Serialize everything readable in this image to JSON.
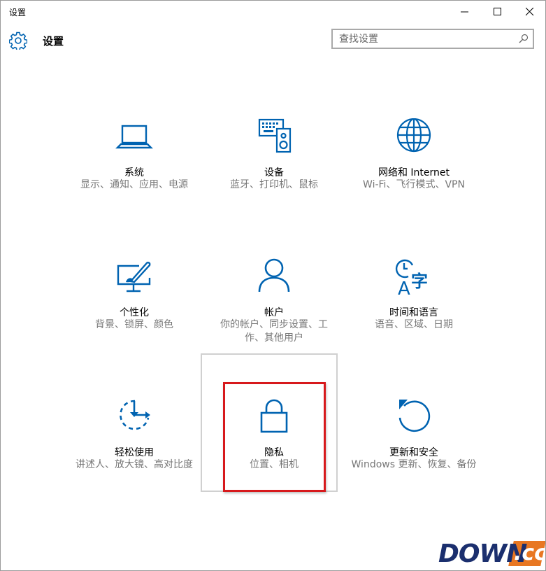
{
  "window": {
    "title": "设置",
    "controls": {
      "minimize": "minimize",
      "maximize": "maximize",
      "close": "close"
    }
  },
  "header": {
    "title": "设置",
    "search": {
      "placeholder": "查找设置",
      "value": ""
    }
  },
  "accent_color": "#0063b1",
  "highlight_color": "#d7191c",
  "tiles": [
    {
      "name": "系统",
      "desc": "显示、通知、应用、电源",
      "icon": "laptop-icon"
    },
    {
      "name": "设备",
      "desc": "蓝牙、打印机、鼠标",
      "icon": "keyboard-speaker-icon"
    },
    {
      "name": "网络和 Internet",
      "desc": "Wi-Fi、飞行模式、VPN",
      "icon": "globe-icon"
    },
    {
      "name": "个性化",
      "desc": "背景、锁屏、颜色",
      "icon": "paint-monitor-icon"
    },
    {
      "name": "帐户",
      "desc": "你的帐户、同步设置、工作、其他用户",
      "icon": "person-icon"
    },
    {
      "name": "时间和语言",
      "desc": "语音、区域、日期",
      "icon": "time-language-icon"
    },
    {
      "name": "轻松使用",
      "desc": "讲述人、放大镜、高对比度",
      "icon": "ease-of-access-icon"
    },
    {
      "name": "隐私",
      "desc": "位置、相机",
      "icon": "lock-icon"
    },
    {
      "name": "更新和安全",
      "desc": "Windows 更新、恢复、备份",
      "icon": "refresh-icon"
    }
  ],
  "watermark": {
    "brand": "DOWN",
    "suffix": ".cc"
  }
}
